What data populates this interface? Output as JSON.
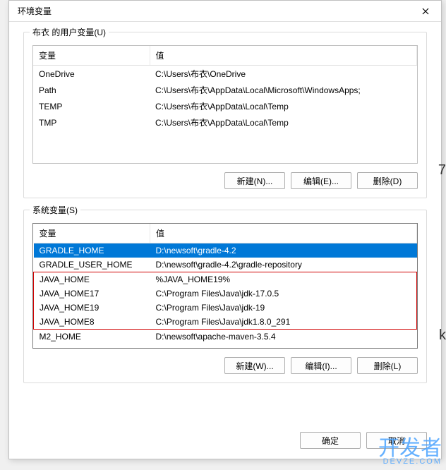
{
  "dialog": {
    "title": "环境变量"
  },
  "userVars": {
    "groupTitle": "布衣 的用户变量(U)",
    "headers": {
      "name": "变量",
      "value": "值"
    },
    "rows": [
      {
        "name": "OneDrive",
        "value": "C:\\Users\\布衣\\OneDrive"
      },
      {
        "name": "Path",
        "value": "C:\\Users\\布衣\\AppData\\Local\\Microsoft\\WindowsApps;"
      },
      {
        "name": "TEMP",
        "value": "C:\\Users\\布衣\\AppData\\Local\\Temp"
      },
      {
        "name": "TMP",
        "value": "C:\\Users\\布衣\\AppData\\Local\\Temp"
      }
    ],
    "buttons": {
      "new": "新建(N)...",
      "edit": "编辑(E)...",
      "delete": "删除(D)"
    }
  },
  "sysVars": {
    "groupTitle": "系统变量(S)",
    "headers": {
      "name": "变量",
      "value": "值"
    },
    "rows": [
      {
        "name": "GRADLE_HOME",
        "value": "D:\\newsoft\\gradle-4.2",
        "selected": true
      },
      {
        "name": "GRADLE_USER_HOME",
        "value": "D:\\newsoft\\gradle-4.2\\gradle-repository"
      },
      {
        "name": "JAVA_HOME",
        "value": "%JAVA_HOME19%",
        "highlight": true
      },
      {
        "name": "JAVA_HOME17",
        "value": "C:\\Program Files\\Java\\jdk-17.0.5",
        "highlight": true
      },
      {
        "name": "JAVA_HOME19",
        "value": "C:\\Program Files\\Java\\jdk-19",
        "highlight": true
      },
      {
        "name": "JAVA_HOME8",
        "value": "C:\\Program Files\\Java\\jdk1.8.0_291",
        "highlight": true
      },
      {
        "name": "M2_HOME",
        "value": "D:\\newsoft\\apache-maven-3.5.4"
      }
    ],
    "buttons": {
      "new": "新建(W)...",
      "edit": "编辑(I)...",
      "delete": "删除(L)"
    }
  },
  "okRow": {
    "ok": "确定",
    "cancel": "取消"
  },
  "watermark": {
    "main": "开发者",
    "sub": "DEVZE.COM"
  },
  "edge": {
    "t1": "7",
    "t2": "k"
  }
}
